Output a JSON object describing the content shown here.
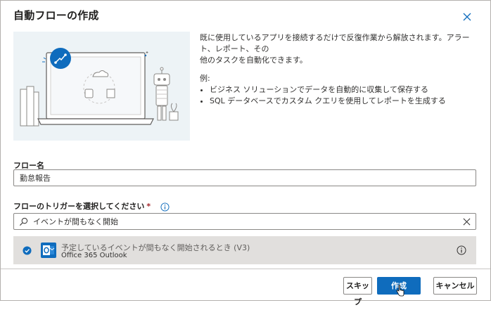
{
  "dialog": {
    "title": "自動フローの作成"
  },
  "description": {
    "intro_line1": "既に使用しているアプリを接続するだけで反復作業から解放されます。アラート、レポート、その",
    "intro_line2": "他のタスクを自動化できます。",
    "examples_label": "例:",
    "examples": [
      "ビジネス ソリューションでデータを自動的に収集して保存する",
      "SQL データベースでカスタム クエリを使用してレポートを生成する"
    ]
  },
  "flow_name": {
    "label": "フロー名",
    "value": "勤怠報告"
  },
  "trigger": {
    "label": "フローのトリガーを選択してください",
    "required_mark": "*",
    "search_value": "イベントが間もなく開始",
    "results": [
      {
        "title": "予定しているイベントが間もなく開始されるとき (V3)",
        "connector": "Office 365 Outlook",
        "icon": "outlook-icon",
        "selected": true
      }
    ]
  },
  "footer": {
    "skip_label": "スキップ",
    "create_label": "作成",
    "cancel_label": "キャンセル"
  },
  "colors": {
    "primary": "#0f6cbd",
    "selected_row": "#e1dfdd",
    "illustration_bg": "#edf3f6",
    "required": "#a4262c"
  }
}
